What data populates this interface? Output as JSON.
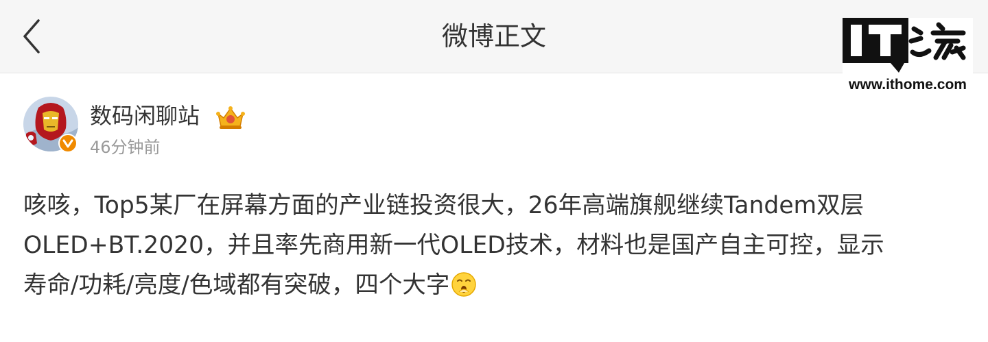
{
  "navbar": {
    "title": "微博正文",
    "back_icon": "chevron-left-icon"
  },
  "watermark": {
    "logo_text": "IT之家",
    "url": "www.ithome.com"
  },
  "post": {
    "author": "数码闲聊站",
    "time": "46分钟前",
    "badges": [
      "verified-v-icon",
      "crown-icon"
    ],
    "lines": [
      "咳咳，Top5某厂在屏幕方面的产业链投资很大，26年高端旗舰继续Tandem双层",
      "OLED+BT.2020，并且率先商用新一代OLED技术，材料也是国产自主可控，显示",
      "寿命/功耗/亮度/色域都有突破，四个大字"
    ],
    "trailing_emoji": "shush-emoji"
  },
  "colors": {
    "navbar_bg": "#f6f6f6",
    "text": "#333333",
    "muted": "#9a9a9a",
    "verified_orange": "#f08a00"
  }
}
